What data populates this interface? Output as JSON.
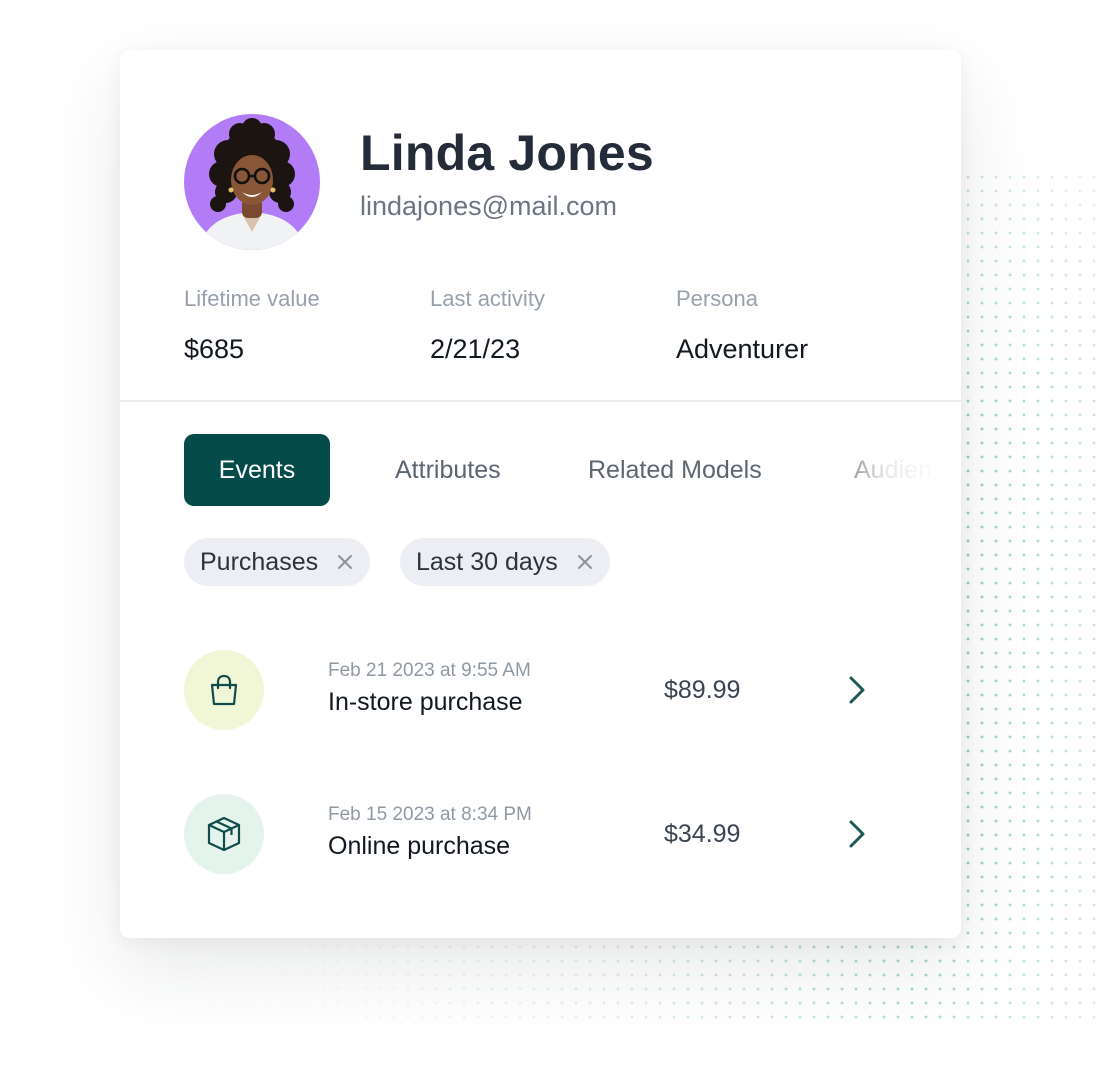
{
  "profile": {
    "name": "Linda Jones",
    "email": "lindajones@mail.com",
    "avatar_bg": "#b27cf7"
  },
  "stats": [
    {
      "label": "Lifetime value",
      "value": "$685"
    },
    {
      "label": "Last activity",
      "value": "2/21/23"
    },
    {
      "label": "Persona",
      "value": "Adventurer"
    }
  ],
  "tabs": [
    {
      "label": "Events",
      "active": true
    },
    {
      "label": "Attributes",
      "active": false
    },
    {
      "label": "Related Models",
      "active": false
    },
    {
      "label": "Audien",
      "active": false
    }
  ],
  "filters": [
    {
      "label": "Purchases"
    },
    {
      "label": "Last 30 days"
    }
  ],
  "events": [
    {
      "date": "Feb 21 2023 at 9:55 AM",
      "title": "In-store purchase",
      "amount": "$89.99",
      "icon": "shopping-bag-icon",
      "icon_bg": "#f1f6d6"
    },
    {
      "date": "Feb 15 2023 at 8:34 PM",
      "title": "Online purchase",
      "amount": "$34.99",
      "icon": "package-box-icon",
      "icon_bg": "#e4f4ec"
    }
  ],
  "colors": {
    "accent": "#054b4a",
    "chip_bg": "#eceef3",
    "dots": "#6cc3a0"
  }
}
